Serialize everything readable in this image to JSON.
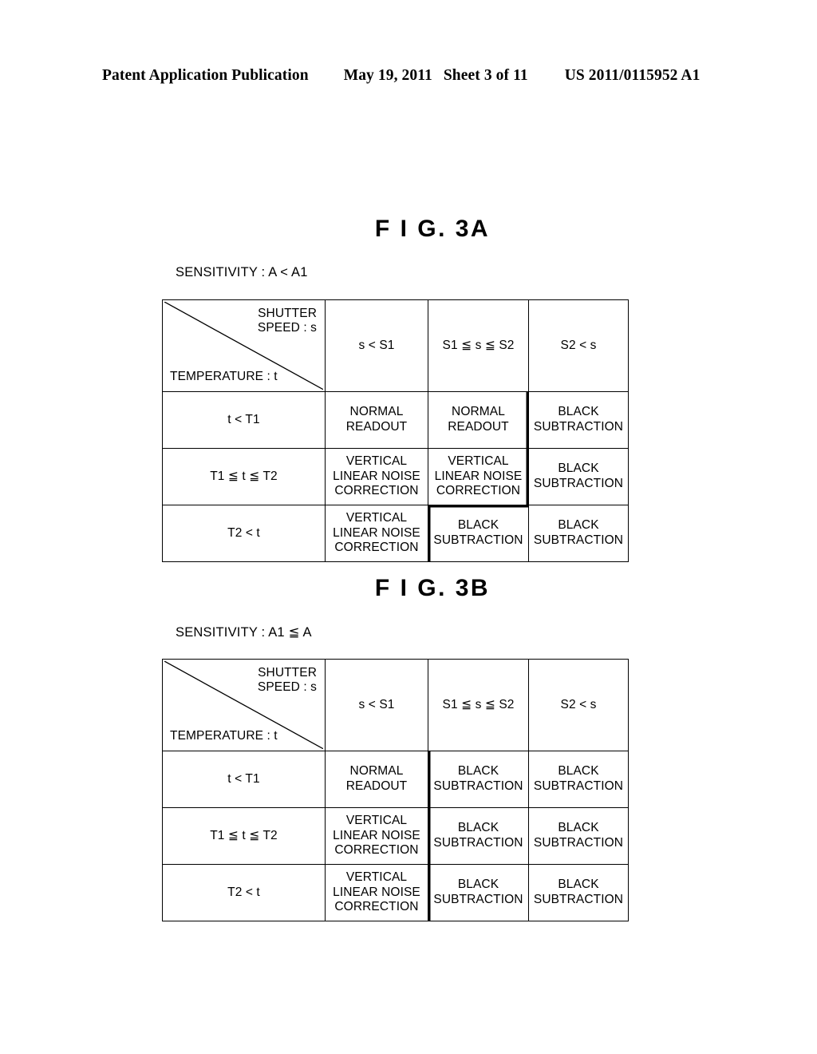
{
  "header": {
    "publication": "Patent Application Publication",
    "date": "May 19, 2011",
    "sheet": "Sheet 3 of 11",
    "number": "US 2011/0115952 A1"
  },
  "figures": [
    {
      "id": "3A",
      "title": "F I G. 3A",
      "caption": "SENSITIVITY : A < A1",
      "corner": {
        "top_label": "SHUTTER\nSPEED : s",
        "bottom_label": "TEMPERATURE : t"
      },
      "column_headers": [
        "s < S1",
        "S1 ≦ s ≦ S2",
        "S2 < s"
      ],
      "row_headers": [
        "t < T1",
        "T1 ≦ t ≦ T2",
        "T2 < t"
      ],
      "cells": [
        [
          "NORMAL\nREADOUT",
          "NORMAL\nREADOUT",
          "BLACK\nSUBTRACTION"
        ],
        [
          "VERTICAL\nLINEAR NOISE\nCORRECTION",
          "VERTICAL\nLINEAR NOISE\nCORRECTION",
          "BLACK\nSUBTRACTION"
        ],
        [
          "VERTICAL\nLINEAR NOISE\nCORRECTION",
          "BLACK\nSUBTRACTION",
          "BLACK\nSUBTRACTION"
        ]
      ],
      "emphasis": [
        [
          "",
          "eb-right",
          ""
        ],
        [
          "",
          "eb-right",
          ""
        ],
        [
          "",
          "eb-left-top",
          ""
        ]
      ]
    },
    {
      "id": "3B",
      "title": "F I G. 3B",
      "caption": "SENSITIVITY : A1 ≦ A",
      "corner": {
        "top_label": "SHUTTER\nSPEED : s",
        "bottom_label": "TEMPERATURE : t"
      },
      "column_headers": [
        "s < S1",
        "S1 ≦ s ≦ S2",
        "S2 < s"
      ],
      "row_headers": [
        "t < T1",
        "T1 ≦ t ≦ T2",
        "T2 < t"
      ],
      "cells": [
        [
          "NORMAL\nREADOUT",
          "BLACK\nSUBTRACTION",
          "BLACK\nSUBTRACTION"
        ],
        [
          "VERTICAL\nLINEAR NOISE\nCORRECTION",
          "BLACK\nSUBTRACTION",
          "BLACK\nSUBTRACTION"
        ],
        [
          "VERTICAL\nLINEAR NOISE\nCORRECTION",
          "BLACK\nSUBTRACTION",
          "BLACK\nSUBTRACTION"
        ]
      ],
      "emphasis": [
        [
          "",
          "eb-left",
          ""
        ],
        [
          "",
          "eb-left",
          ""
        ],
        [
          "",
          "eb-left",
          ""
        ]
      ]
    }
  ],
  "colors": {
    "ink": "#000000",
    "page": "#ffffff"
  }
}
